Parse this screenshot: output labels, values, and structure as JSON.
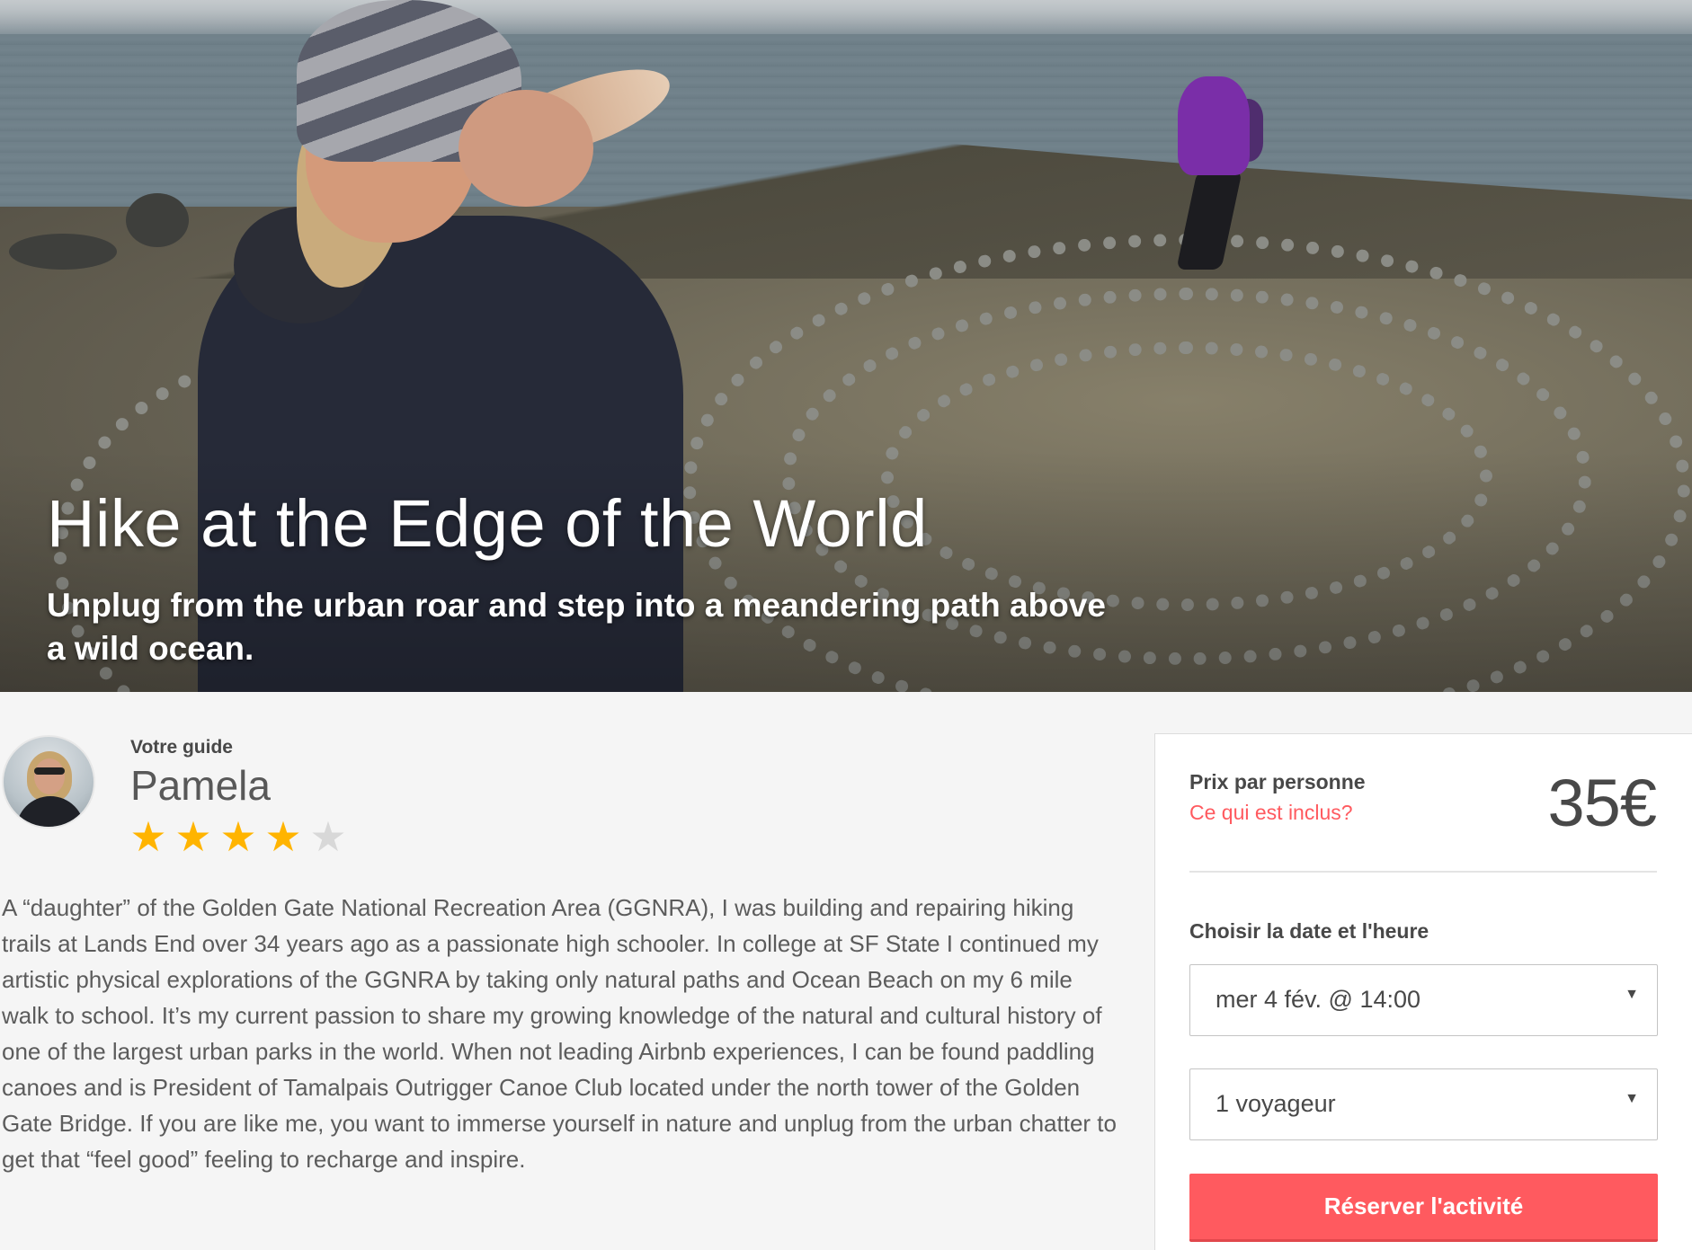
{
  "hero": {
    "title": "Hike at the Edge of the World",
    "subtitle": "Unplug from the urban roar and step into a meandering path above a wild ocean."
  },
  "guide": {
    "label": "Votre guide",
    "name": "Pamela",
    "rating": 4,
    "rating_max": 5,
    "bio": "A “daughter” of the Golden Gate National Recreation Area (GGNRA), I was building and repairing hiking trails at Lands End over 34 years ago as a passionate high schooler. In college at SF State I continued my artistic physical explorations of the GGNRA by taking only natural paths and Ocean Beach on my 6 mile walk to school. It’s my current passion to share my growing knowledge of the natural and cultural history of one of the largest urban parks in the world. When not leading Airbnb experiences, I can be found paddling canoes and is President of Tamalpais Outrigger Canoe Club located under the north tower of the Golden Gate Bridge. If you are like me, you want to immerse yourself in nature and unplug from the urban chatter to get that “feel good” feeling to recharge and inspire."
  },
  "booking": {
    "price_label": "Prix par personne",
    "included_link": "Ce qui est inclus?",
    "price": "35€",
    "date_label": "Choisir la date et l'heure",
    "date_value": "mer 4 fév. @ 14:00",
    "guests_value": "1 voyageur",
    "book_button": "Réserver l'activité"
  },
  "icons": {
    "star": "★",
    "caret": "▼"
  },
  "colors": {
    "accent": "#ff5a5f",
    "star_on": "#ffb400",
    "star_off": "#d8d8d8"
  }
}
